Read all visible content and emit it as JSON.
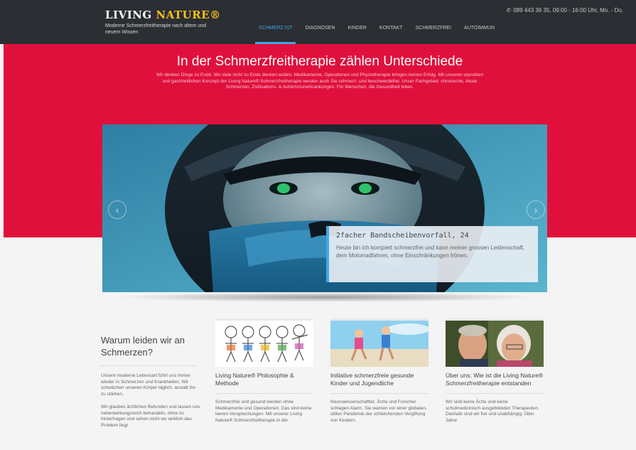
{
  "header": {
    "logo_main": "LIVING ",
    "logo_accent": "NATURE®",
    "logo_sub": "Moderne Schmerzfreitherapie nach altem und neuem Wissen",
    "phone": "089 443 36 35, 09:00 - 16:00 Uhr, Mo. - Do.",
    "nav": [
      {
        "label": "Schmerz ist"
      },
      {
        "label": "Diagnosen"
      },
      {
        "label": "Kinder"
      },
      {
        "label": "Kontakt"
      },
      {
        "label": "Schmerzfrei"
      },
      {
        "label": "Autoimmun"
      }
    ]
  },
  "hero": {
    "title": "In der Schmerzfreitherapie zählen Unterschiede",
    "text": "Wir denken Dinge zu Ende. Wo viele nicht zu Ende denken wollen. Medikamente, Operationen und Physiotherapie bringen keinen Erfolg. Mit unseren erprobten und ganzheitlichen Konzept der Living Nature® Schmerzfreitherapie werden auch Sie schmerz- und beschwerdefrei. Unser Fachgebiet: chronische, Akute Schmerzen, Zivilisations- & Autoimmunerkrankungen. Für Menschen, die Gesundheit leben."
  },
  "slider": {
    "caption_title": "2facher Bandscheibenvorfall, 24",
    "caption_text": "Heute bin ich komplett schmerzfrei und kann meiner grossen Leidenschaft, dem Motorradfahren, ohne Einschränkungen frönen.",
    "prev_icon": "chevron-left-icon",
    "next_icon": "chevron-right-icon"
  },
  "intro": {
    "heading": "Warum leiden wir an Schmerzen?",
    "text1": "Unsere moderne Lebensart führt uns immer wieder in Schmerzen und Krankheiten. Wir schwächen unseren Körper täglich, anstatt ihn zu stärken.",
    "text2": "Wir glauben ärztlichen Befunden und lassen uns nebenwirkungsreich behandeln, ohne zu hinterfragen und sehen nicht wo wirklich das Problem liegt."
  },
  "cards": [
    {
      "title": "Living Nature® Philosophie & Methode",
      "text": "Schmerzfrei und gesund werden ohne Medikamente und Operationen. Das sind keine leeren Versprechungen. Mit unserer Living Nature® Schmerzfreitherapie in der"
    },
    {
      "title": "Initiative schmerzfreie gesunde Kinder und Jugendliche",
      "text": "Neurowissenschaftler, Ärzte und Forscher schlagen Alarm. Sie warnen vor einer globalen, stillen Pandemie der schleichenden Vergiftung von Kindern."
    },
    {
      "title": "Über uns: Wie ist die Living Nature® Schmerzfreitherapie entstanden",
      "text": "Wir sind keine Ärzte und keine schulmedizinisch ausgebildeten Therapeuten. Deshalb sind wir frei und unabhängig. Über Jahre"
    }
  ],
  "colors": {
    "header_bg": "#2b2e33",
    "hero_red": "#e0103c",
    "accent_blue": "#3fa9e6",
    "logo_yellow": "#f7c21a"
  }
}
